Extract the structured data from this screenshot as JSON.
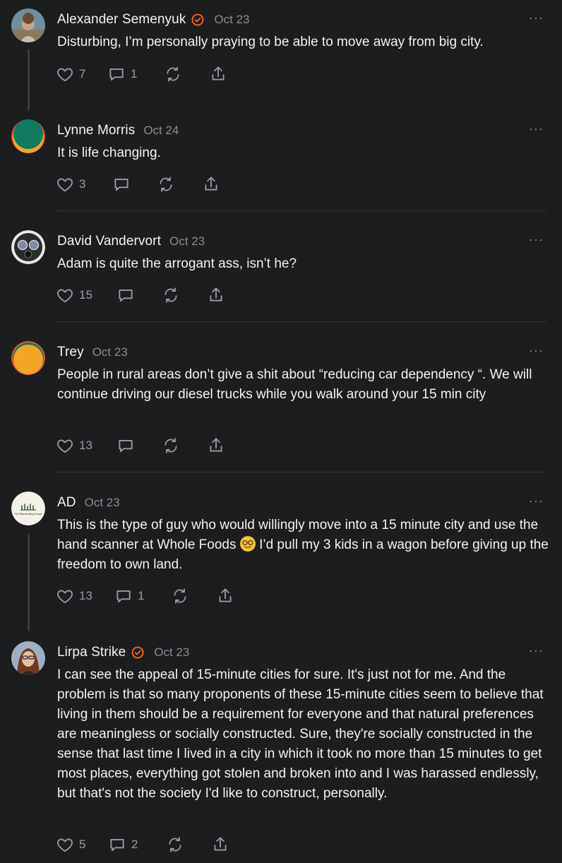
{
  "comments": [
    {
      "name": "Alexander Semenyuk",
      "verified": true,
      "date": "Oct 23",
      "text": "Disturbing, I’m personally praying to be able to move away from big city.",
      "likes": "7",
      "replies": "1"
    },
    {
      "name": "Lynne Morris",
      "verified": false,
      "date": "Oct 24",
      "text": "It is life changing.",
      "likes": "3",
      "replies": ""
    },
    {
      "name": "David Vandervort",
      "verified": false,
      "date": "Oct 23",
      "text": "Adam is quite the arrogant ass, isn’t he?",
      "likes": "15",
      "replies": ""
    },
    {
      "name": "Trey",
      "verified": false,
      "date": "Oct 23",
      "text": "People in rural areas don’t give a shit about “reducing car dependency “. We will continue driving our diesel trucks while you walk around your 15 min city",
      "likes": "13",
      "replies": ""
    },
    {
      "name": "AD",
      "verified": false,
      "date": "Oct 23",
      "text_before_emoji": "This is the type of guy who would willingly move into a 15 minute city and use the hand scanner at Whole Foods",
      "text_after_emoji": "I’d pull my 3 kids in a wagon before giving up the freedom to own land.",
      "likes": "13",
      "replies": "1",
      "avatar_logo_text": "The Homesteading Journal"
    },
    {
      "name": "Lirpa Strike",
      "verified": true,
      "date": "Oct 23",
      "text": "I can see the appeal of 15-minute cities for sure. It's just not for me. And the problem is that so many proponents of these 15-minute cities seem to believe that living in them should be a requirement for everyone and that natural preferences are meaningless or socially constructed. Sure, they're socially constructed in the sense that last time I lived in a city in which it took no more than 15 minutes to get most places, everything got stolen and broken into and I was harassed endlessly, but that's not the society I'd like to construct, personally.",
      "likes": "5",
      "replies": "2"
    }
  ],
  "ui": {
    "more_icon": "···"
  },
  "colors": {
    "background": "#1c1d1f",
    "verified_badge": "#ff6719",
    "muted": "#8b8c90"
  }
}
